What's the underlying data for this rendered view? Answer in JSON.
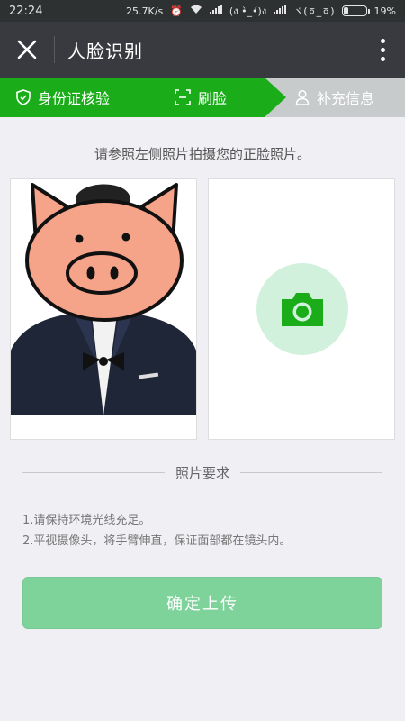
{
  "status_bar": {
    "time": "22:24",
    "speed": "25.7K/s",
    "extra": "(ง •̀_•́)ง",
    "extra2": "ヾ(ㆆ_ㆆ)",
    "battery": "19%"
  },
  "header": {
    "title": "人脸识别"
  },
  "steps": [
    {
      "label": "身份证核验",
      "state": "done"
    },
    {
      "label": "刷脸",
      "state": "active"
    },
    {
      "label": "补充信息",
      "state": "pending"
    }
  ],
  "instruction": "请参照左侧照片拍摄您的正脸照片。",
  "requirements": {
    "title": "照片要求",
    "items": [
      "1.请保持环境光线充足。",
      "2.平视摄像头，将手臂伸直，保证面部都在镜头内。"
    ]
  },
  "confirm_button": "确定上传",
  "colors": {
    "accent": "#1aad19",
    "button_disabled": "#7ed39a",
    "title_bar": "#393a3f",
    "pending_step": "#c8cbcc"
  },
  "icons": [
    "close-icon",
    "more-icon",
    "shield-icon",
    "face-scan-icon",
    "user-icon",
    "camera-icon"
  ]
}
